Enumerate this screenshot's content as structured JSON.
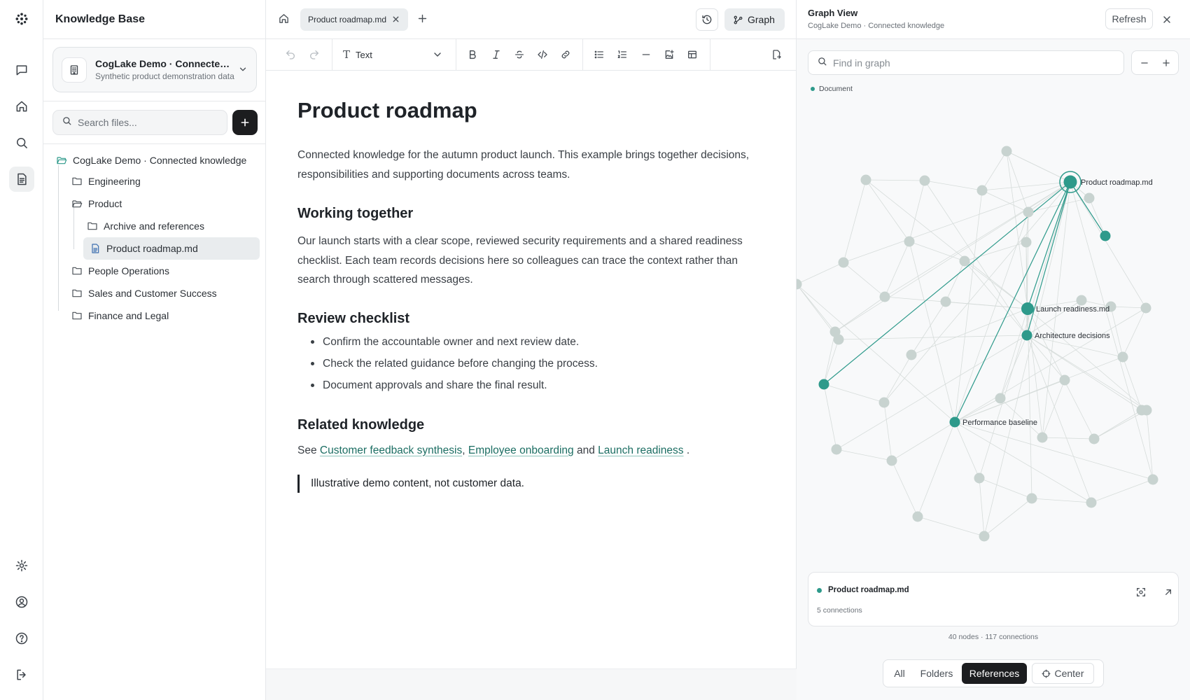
{
  "rail": {
    "items": [
      "chat",
      "home",
      "search",
      "knowledge-base"
    ],
    "bottom": [
      "settings",
      "account",
      "help",
      "logout"
    ]
  },
  "explorer": {
    "title": "Knowledge Base",
    "workspace": {
      "name": "CogLake Demo · Connected knowledge",
      "description": "Synthetic product demonstration data"
    },
    "search_placeholder": "Search files...",
    "tree": [
      {
        "label": "CogLake Demo · Connected knowledge",
        "type": "folder-open",
        "depth": 0
      },
      {
        "label": "Engineering",
        "type": "folder",
        "depth": 1
      },
      {
        "label": "Product",
        "type": "folder-open",
        "depth": 1
      },
      {
        "label": "Archive and references",
        "type": "folder",
        "depth": 2
      },
      {
        "label": "Product roadmap.md",
        "type": "file",
        "depth": 2,
        "selected": true
      },
      {
        "label": "People Operations",
        "type": "folder",
        "depth": 1
      },
      {
        "label": "Sales and Customer Success",
        "type": "folder",
        "depth": 1
      },
      {
        "label": "Finance and Legal",
        "type": "folder",
        "depth": 1
      }
    ]
  },
  "editor": {
    "tab_label": "Product roadmap.md",
    "graph_button": "Graph",
    "block_type": "Text",
    "doc": {
      "title": "Product roadmap",
      "intro": "Connected knowledge for the autumn product launch. This example brings together decisions, responsibilities and supporting documents across teams.",
      "h_working": "Working together",
      "p_working": "Our launch starts with a clear scope, reviewed security requirements and a shared readiness checklist. Each team records decisions here so colleagues can trace the context rather than search through scattered messages.",
      "h_review": "Review checklist",
      "checklist": [
        "Confirm the accountable owner and next review date.",
        "Check the related guidance before changing the process.",
        "Document approvals and share the final result."
      ],
      "h_related": "Related knowledge",
      "see": "See",
      "links": [
        "Customer feedback synthesis",
        "Employee onboarding",
        "Launch readiness"
      ],
      "sep_comma": ",",
      "sep_and": "and",
      "sep_period": ".",
      "quote": "Illustrative demo content, not customer data."
    }
  },
  "graph": {
    "title": "Graph View",
    "subtitle": "CogLake Demo · Connected knowledge",
    "refresh": "Refresh",
    "search_placeholder": "Find in graph",
    "legend": "Document",
    "accent": "#2e9a8b",
    "node_color": "#c8d3d0",
    "edge_color": "#d6dcda",
    "labels": {
      "selected": "Product roadmap.md",
      "launch": "Launch readiness.md",
      "arch": "Architecture decisions",
      "perf": "Performance baseline"
    },
    "selected_node": {
      "name": "Product roadmap.md",
      "connections": "5 connections"
    },
    "stats": "40 nodes · 117 connections",
    "filters": {
      "all": "All",
      "folders": "Folders",
      "references": "References",
      "center": "Center",
      "active": "References"
    }
  }
}
